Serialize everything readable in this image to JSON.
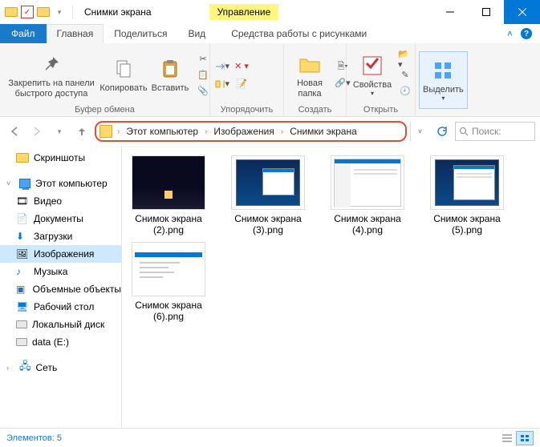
{
  "window": {
    "title": "Снимки экрана",
    "context_label": "Управление"
  },
  "tabs": {
    "file": "Файл",
    "home": "Главная",
    "share": "Поделиться",
    "view": "Вид",
    "context": "Средства работы с рисунками"
  },
  "ribbon": {
    "pin": "Закрепить на панели\nбыстрого доступа",
    "copy": "Копировать",
    "paste": "Вставить",
    "group_clipboard": "Буфер обмена",
    "group_organize": "Упорядочить",
    "newfolder": "Новая\nпапка",
    "group_new": "Создать",
    "properties": "Свойства",
    "group_open": "Открыть",
    "select": "Выделить",
    "group_select": ""
  },
  "breadcrumb": [
    "Этот компьютер",
    "Изображения",
    "Снимки экрана"
  ],
  "search_placeholder": "Поиск: ",
  "tree": {
    "screenshots": "Скриншоты",
    "this_pc": "Этот компьютер",
    "videos": "Видео",
    "documents": "Документы",
    "downloads": "Загрузки",
    "pictures": "Изображения",
    "music": "Музыка",
    "objects3d": "Объемные объекты",
    "desktop": "Рабочий стол",
    "local_c": "Локальный диск",
    "data_e": "data (E:)",
    "network": "Сеть"
  },
  "items": [
    {
      "name": "Снимок экрана (2).png"
    },
    {
      "name": "Снимок экрана (3).png"
    },
    {
      "name": "Снимок экрана (4).png"
    },
    {
      "name": "Снимок экрана (5).png"
    },
    {
      "name": "Снимок экрана (6).png"
    }
  ],
  "status": {
    "count_label": "Элементов: 5"
  }
}
